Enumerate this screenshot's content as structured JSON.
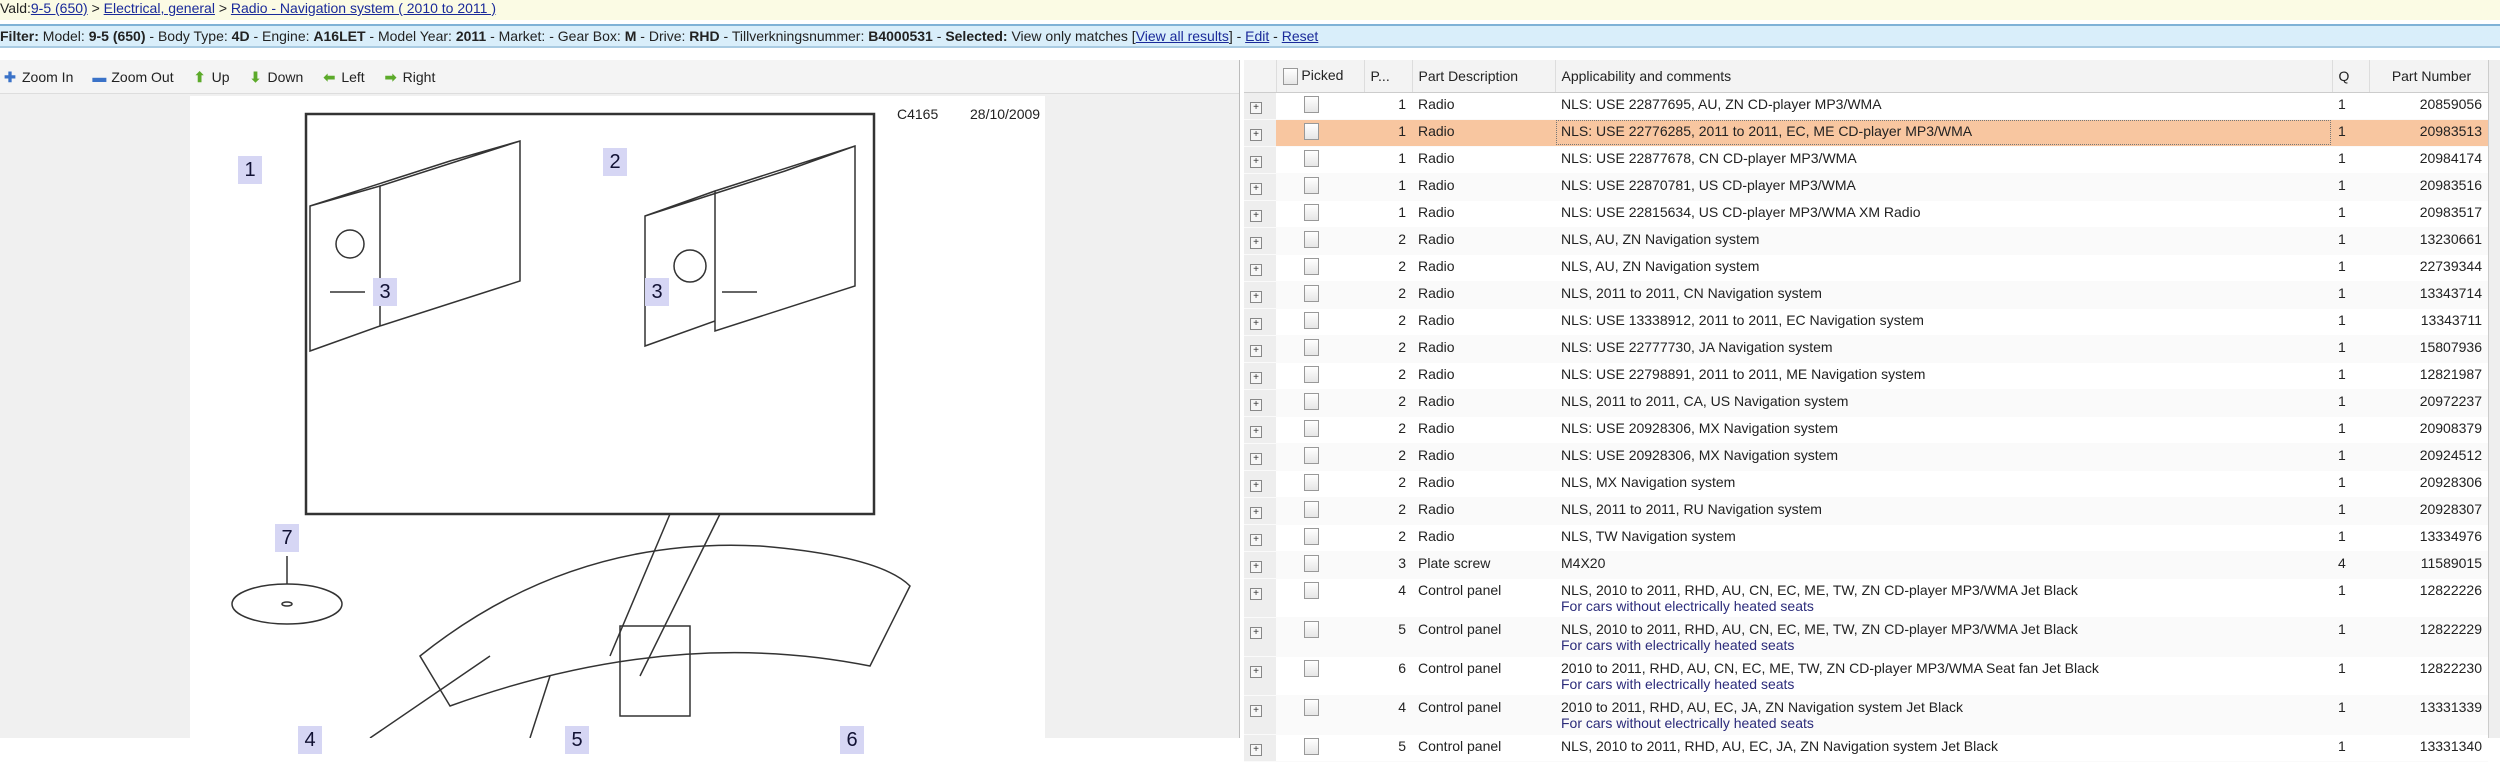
{
  "breadcrumb": {
    "prefix": "Vald:",
    "items": [
      "9-5 (650)",
      "Electrical, general",
      "Radio - Navigation system ( 2010 to 2011 )"
    ],
    "sep": " > "
  },
  "filter": {
    "label": "Filter:",
    "model_k": "Model:",
    "model": "9-5 (650)",
    "body_k": "Body Type:",
    "body": "4D",
    "engine_k": "Engine:",
    "engine": "A16LET",
    "year_k": "Model Year:",
    "year": "2011",
    "market_k": "Market:",
    "gear_k": "Gear Box:",
    "gear": "M",
    "drive_k": "Drive:",
    "drive": "RHD",
    "tvn_k": "Tillverkningsnummer:",
    "tvn": "B4000531",
    "sel_k": "Selected:",
    "sel": "View only matches",
    "view_all": "View all results",
    "edit": "Edit",
    "reset": "Reset"
  },
  "toolbar": {
    "zoom_in": "Zoom In",
    "zoom_out": "Zoom Out",
    "up": "Up",
    "down": "Down",
    "left": "Left",
    "right": "Right"
  },
  "diagram": {
    "code": "C4165",
    "date": "28/10/2009",
    "callouts": [
      "1",
      "2",
      "3",
      "3",
      "7",
      "4",
      "5",
      "6"
    ]
  },
  "table": {
    "headers": [
      "Picked",
      "P...",
      "Part Description",
      "Applicability and comments",
      "Q",
      "Part Number"
    ],
    "rows": [
      {
        "p": "1",
        "desc": "Radio",
        "app": "NLS: USE 22877695, AU, ZN CD-player MP3/WMA",
        "q": "1",
        "pn": "20859056"
      },
      {
        "p": "1",
        "desc": "Radio",
        "app": "NLS: USE 22776285, 2011 to 2011, EC, ME CD-player MP3/WMA",
        "q": "1",
        "pn": "20983513",
        "selected": true
      },
      {
        "p": "1",
        "desc": "Radio",
        "app": "NLS: USE 22877678, CN CD-player MP3/WMA",
        "q": "1",
        "pn": "20984174"
      },
      {
        "p": "1",
        "desc": "Radio",
        "app": "NLS: USE 22870781, US CD-player MP3/WMA",
        "q": "1",
        "pn": "20983516"
      },
      {
        "p": "1",
        "desc": "Radio",
        "app": "NLS: USE 22815634, US CD-player MP3/WMA XM Radio",
        "q": "1",
        "pn": "20983517"
      },
      {
        "p": "2",
        "desc": "Radio",
        "app": "NLS, AU, ZN Navigation system",
        "q": "1",
        "pn": "13230661"
      },
      {
        "p": "2",
        "desc": "Radio",
        "app": "NLS, AU, ZN Navigation system",
        "q": "1",
        "pn": "22739344"
      },
      {
        "p": "2",
        "desc": "Radio",
        "app": "NLS, 2011 to 2011, CN Navigation system",
        "q": "1",
        "pn": "13343714"
      },
      {
        "p": "2",
        "desc": "Radio",
        "app": "NLS: USE 13338912, 2011 to 2011, EC Navigation system",
        "q": "1",
        "pn": "13343711"
      },
      {
        "p": "2",
        "desc": "Radio",
        "app": "NLS: USE 22777730, JA Navigation system",
        "q": "1",
        "pn": "15807936"
      },
      {
        "p": "2",
        "desc": "Radio",
        "app": "NLS: USE 22798891, 2011 to 2011, ME Navigation system",
        "q": "1",
        "pn": "12821987"
      },
      {
        "p": "2",
        "desc": "Radio",
        "app": "NLS, 2011 to 2011, CA, US Navigation system",
        "q": "1",
        "pn": "20972237"
      },
      {
        "p": "2",
        "desc": "Radio",
        "app": "NLS: USE 20928306, MX Navigation system",
        "q": "1",
        "pn": "20908379"
      },
      {
        "p": "2",
        "desc": "Radio",
        "app": "NLS: USE 20928306, MX Navigation system",
        "q": "1",
        "pn": "20924512"
      },
      {
        "p": "2",
        "desc": "Radio",
        "app": "NLS, MX Navigation system",
        "q": "1",
        "pn": "20928306"
      },
      {
        "p": "2",
        "desc": "Radio",
        "app": "NLS, 2011 to 2011, RU Navigation system",
        "q": "1",
        "pn": "20928307"
      },
      {
        "p": "2",
        "desc": "Radio",
        "app": "NLS, TW Navigation system",
        "q": "1",
        "pn": "13334976"
      },
      {
        "p": "3",
        "desc": "Plate screw",
        "app": "M4X20",
        "q": "4",
        "pn": "11589015"
      },
      {
        "p": "4",
        "desc": "Control panel",
        "app": "NLS, 2010 to 2011, RHD, AU, CN, EC, ME, TW, ZN CD-player MP3/WMA Jet Black",
        "comment": "For cars without electrically heated seats",
        "q": "1",
        "pn": "12822226"
      },
      {
        "p": "5",
        "desc": "Control panel",
        "app": "NLS, 2010 to 2011, RHD, AU, CN, EC, ME, TW, ZN CD-player MP3/WMA Jet Black",
        "comment": "For cars with electrically heated seats",
        "q": "1",
        "pn": "12822229"
      },
      {
        "p": "6",
        "desc": "Control panel",
        "app": "2010 to 2011, RHD, AU, CN, EC, ME, TW, ZN CD-player MP3/WMA Seat fan Jet Black",
        "comment": "For cars with electrically heated seats",
        "q": "1",
        "pn": "12822230"
      },
      {
        "p": "4",
        "desc": "Control panel",
        "app": "2010 to 2011, RHD, AU, EC, JA, ZN Navigation system Jet Black",
        "comment": "For cars without electrically heated seats",
        "q": "1",
        "pn": "13331339"
      },
      {
        "p": "5",
        "desc": "Control panel",
        "app": "NLS, 2010 to 2011, RHD, AU, EC, JA, ZN Navigation system Jet Black",
        "q": "1",
        "pn": "13331340"
      }
    ]
  }
}
